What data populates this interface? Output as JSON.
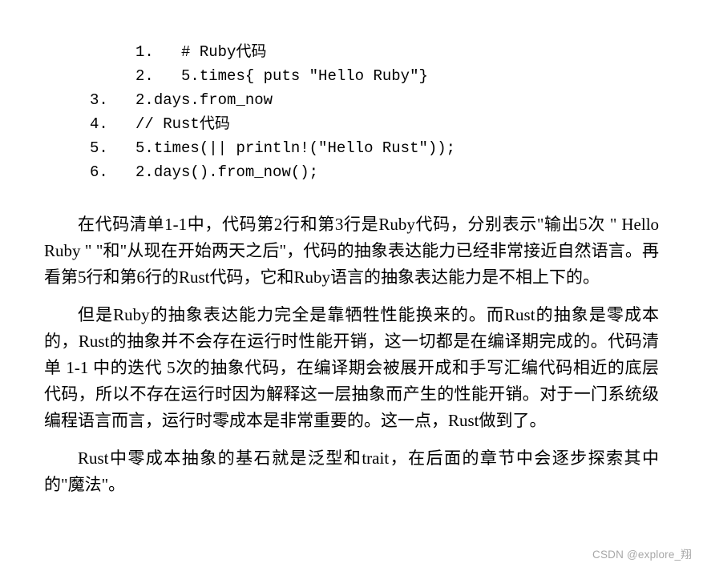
{
  "code": {
    "lines": [
      "          1.   # Ruby代码",
      "          2.   5.times{ puts \"Hello Ruby\"}",
      "     3.   2.days.from_now",
      "     4.   // Rust代码",
      "     5.   5.times(|| println!(\"Hello Rust\"));",
      "     6.   2.days().from_now();"
    ]
  },
  "paragraphs": {
    "p1": {
      "s1": "在代码清单",
      "s2": "1-1",
      "s3": "中，代码第",
      "s4": "2",
      "s5": "行和第",
      "s6": "3",
      "s7": "行是",
      "s8": "Ruby",
      "s9": "代码，分别表示\"输出",
      "s10": "5",
      "s11": "次 \" ",
      "s12": "Hello   Ruby",
      "s13": " \" \"和\"从现在开始两天之后\"，代码的抽象表达能力已经非常接近自然语言。再看第",
      "s14": "5",
      "s15": "行和第",
      "s16": "6",
      "s17": "行的",
      "s18": "Rust",
      "s19": "代码，它和",
      "s20": "Ruby",
      "s21": "语言的抽象表达能力是不相上下的。"
    },
    "p2": {
      "s1": "但是",
      "s2": "Ruby",
      "s3": "的抽象表达能力完全是靠牺牲性能换来的。而",
      "s4": "Rust",
      "s5": "的抽象是零成本的，",
      "s6": "Rust",
      "s7": "的抽象并不会存在运行时性能开销，这一切都是在编译期完成的。代码清单 ",
      "s8": "1-1",
      "s9": " 中的迭代 ",
      "s10": "5",
      "s11": "次的抽象代码，在编译期会被展开成和手写汇编代码相近的底层代码，所以不存在运行时因为解释这一层抽象而产生的性能开销。对于一门系统级编程语言而言，运行时零成本是非常重要的。这一点，",
      "s12": "Rust",
      "s13": "做到了。"
    },
    "p3": {
      "s1": "Rust",
      "s2": "中零成本抽象的基石就是泛型和",
      "s3": "trait",
      "s4": "，在后面的章节中会逐步探索其中的\"魔法\"。"
    }
  },
  "watermark": "CSDN @explore_翔"
}
